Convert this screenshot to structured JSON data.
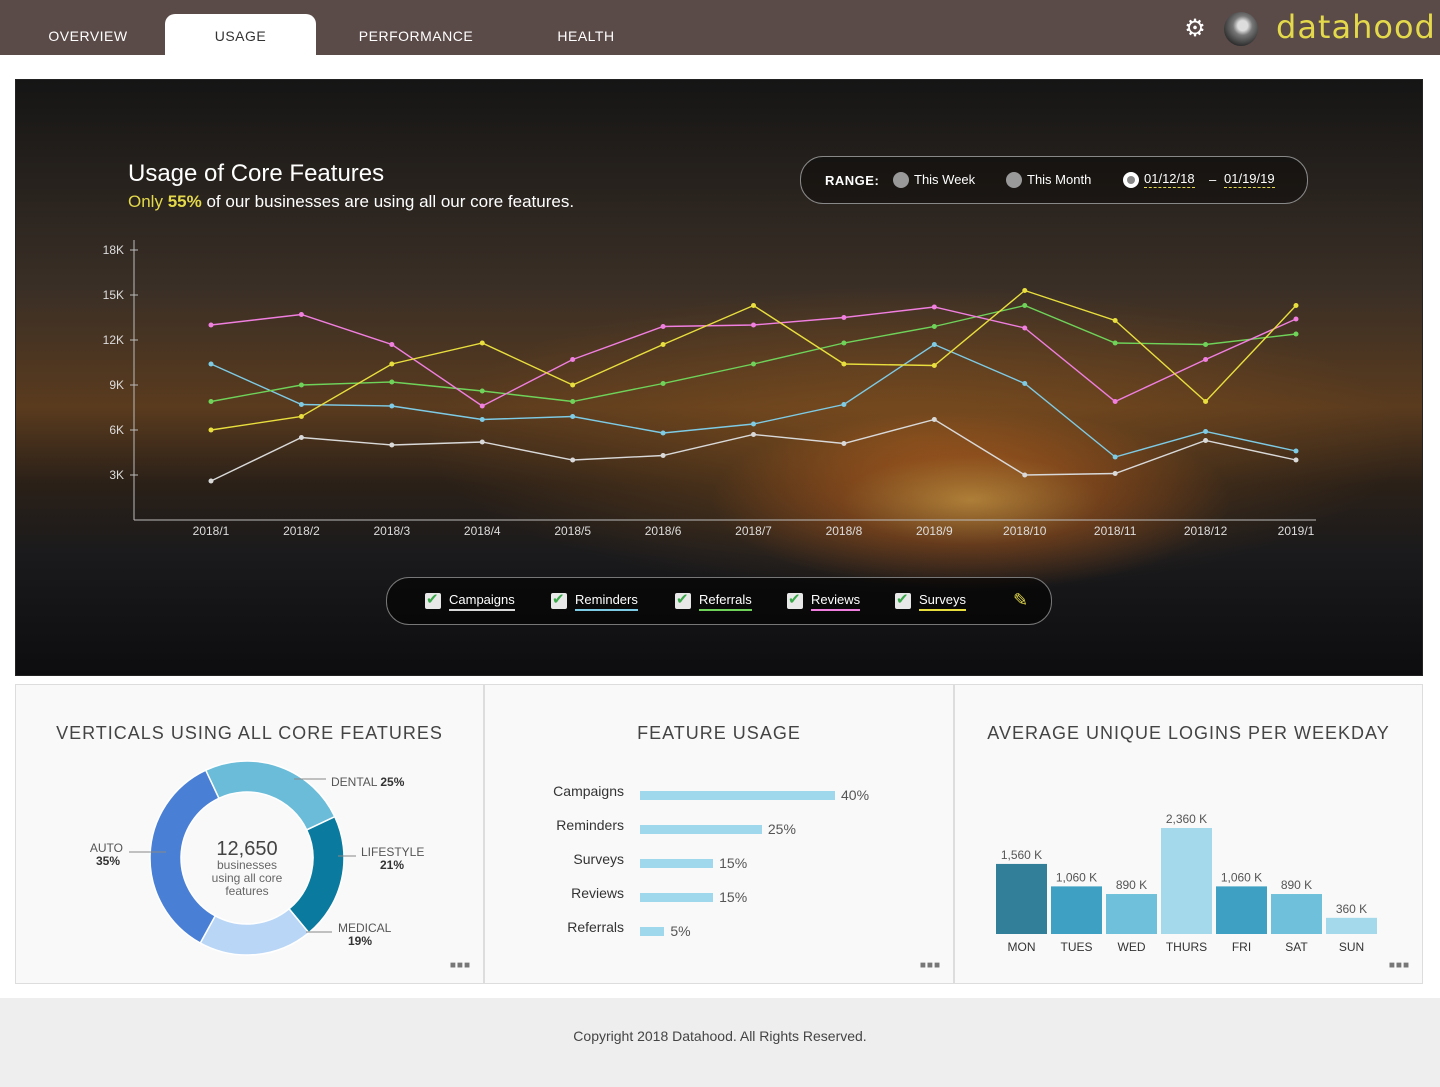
{
  "nav": {
    "tabs": [
      {
        "label": "OVERVIEW"
      },
      {
        "label": "USAGE"
      },
      {
        "label": "PERFORMANCE"
      },
      {
        "label": "HEALTH"
      }
    ],
    "brand": "datahood",
    "settings_icon": "gear-icon",
    "avatar_icon": "user-avatar"
  },
  "hero": {
    "title": "Usage of Core Features",
    "subtitle_prefix": "Only",
    "subtitle_value": "55%",
    "subtitle_suffix": "of our businesses are using all our core features.",
    "range": {
      "label": "RANGE:",
      "options": [
        "This Week",
        "This Month"
      ],
      "start_date": "01/12/18",
      "separator": "–",
      "end_date": "01/19/19"
    },
    "legend": [
      "Campaigns",
      "Reminders",
      "Referrals",
      "Reviews",
      "Surveys"
    ],
    "edit_icon": "pencil-icon"
  },
  "chart_data": [
    {
      "type": "line",
      "title": "Usage of Core Features",
      "categories": [
        "2018/1",
        "2018/2",
        "2018/3",
        "2018/4",
        "2018/5",
        "2018/6",
        "2018/7",
        "2018/8",
        "2018/9",
        "2018/10",
        "2018/11",
        "2018/12",
        "2019/1"
      ],
      "y_ticks": [
        "18K",
        "15K",
        "12K",
        "9K",
        "6K",
        "3K"
      ],
      "ylim": [
        0,
        18000
      ],
      "grid": false,
      "series": [
        {
          "name": "Campaigns",
          "color": "#d9d9d9",
          "values": [
            2600,
            5500,
            5000,
            5200,
            4000,
            4300,
            5700,
            5100,
            6700,
            3000,
            3100,
            5300,
            4000
          ]
        },
        {
          "name": "Reminders",
          "color": "#7ecbe6",
          "values": [
            10400,
            7700,
            7600,
            6700,
            6900,
            5800,
            6400,
            7700,
            11700,
            9100,
            4200,
            5900,
            4600
          ]
        },
        {
          "name": "Referrals",
          "color": "#6fd35a",
          "values": [
            7900,
            9000,
            9200,
            8600,
            7900,
            9100,
            10400,
            11800,
            12900,
            14300,
            11800,
            11700,
            12400
          ]
        },
        {
          "name": "Reviews",
          "color": "#f07fe0",
          "values": [
            13000,
            13700,
            11700,
            7600,
            10700,
            12900,
            13000,
            13500,
            14200,
            12800,
            7900,
            10700,
            13400
          ]
        },
        {
          "name": "Surveys",
          "color": "#e8de3e",
          "values": [
            6000,
            6900,
            10400,
            11800,
            9000,
            11700,
            14300,
            10400,
            10300,
            15300,
            13300,
            7900,
            14300
          ]
        }
      ]
    },
    {
      "type": "pie",
      "title": "VERTICALS USING ALL CORE FEATURES",
      "center_value": "12,650",
      "center_text_1": "businesses",
      "center_text_2": "using all core",
      "center_text_3": "features",
      "slices": [
        {
          "name": "DENTAL",
          "pct": "25%",
          "value": 25,
          "color": "#6bbcd8"
        },
        {
          "name": "LIFESTYLE",
          "pct": "21%",
          "value": 21,
          "color": "#0a7a9e"
        },
        {
          "name": "MEDICAL",
          "pct": "19%",
          "value": 19,
          "color": "#b9d6f6"
        },
        {
          "name": "AUTO",
          "pct": "35%",
          "value": 35,
          "color": "#4a7fd6"
        }
      ]
    },
    {
      "type": "bar",
      "title": "FEATURE USAGE",
      "categories": [
        "Campaigns",
        "Reminders",
        "Surveys",
        "Reviews",
        "Referrals"
      ],
      "labels": [
        "40%",
        "25%",
        "15%",
        "15%",
        "5%"
      ],
      "values": [
        40,
        25,
        15,
        15,
        5
      ]
    },
    {
      "type": "bar",
      "title": "AVERAGE UNIQUE LOGINS PER WEEKDAY",
      "categories": [
        "MON",
        "TUES",
        "WED",
        "THURS",
        "FRI",
        "SAT",
        "SUN"
      ],
      "labels": [
        "1,560 K",
        "1,060 K",
        "890 K",
        "2,360 K",
        "1,060 K",
        "890 K",
        "360 K"
      ],
      "values": [
        1560,
        1060,
        890,
        2360,
        1060,
        890,
        360
      ],
      "colors": [
        "#327f99",
        "#3ea0c3",
        "#6fc0da",
        "#a3d9ea",
        "#3ea0c3",
        "#6fc0da",
        "#a3d9ea"
      ]
    }
  ],
  "panels": {
    "more_icon": "more-dots-icon"
  },
  "footer": {
    "copyright": "Copyright 2018 Datahood. All Rights Reserved."
  }
}
